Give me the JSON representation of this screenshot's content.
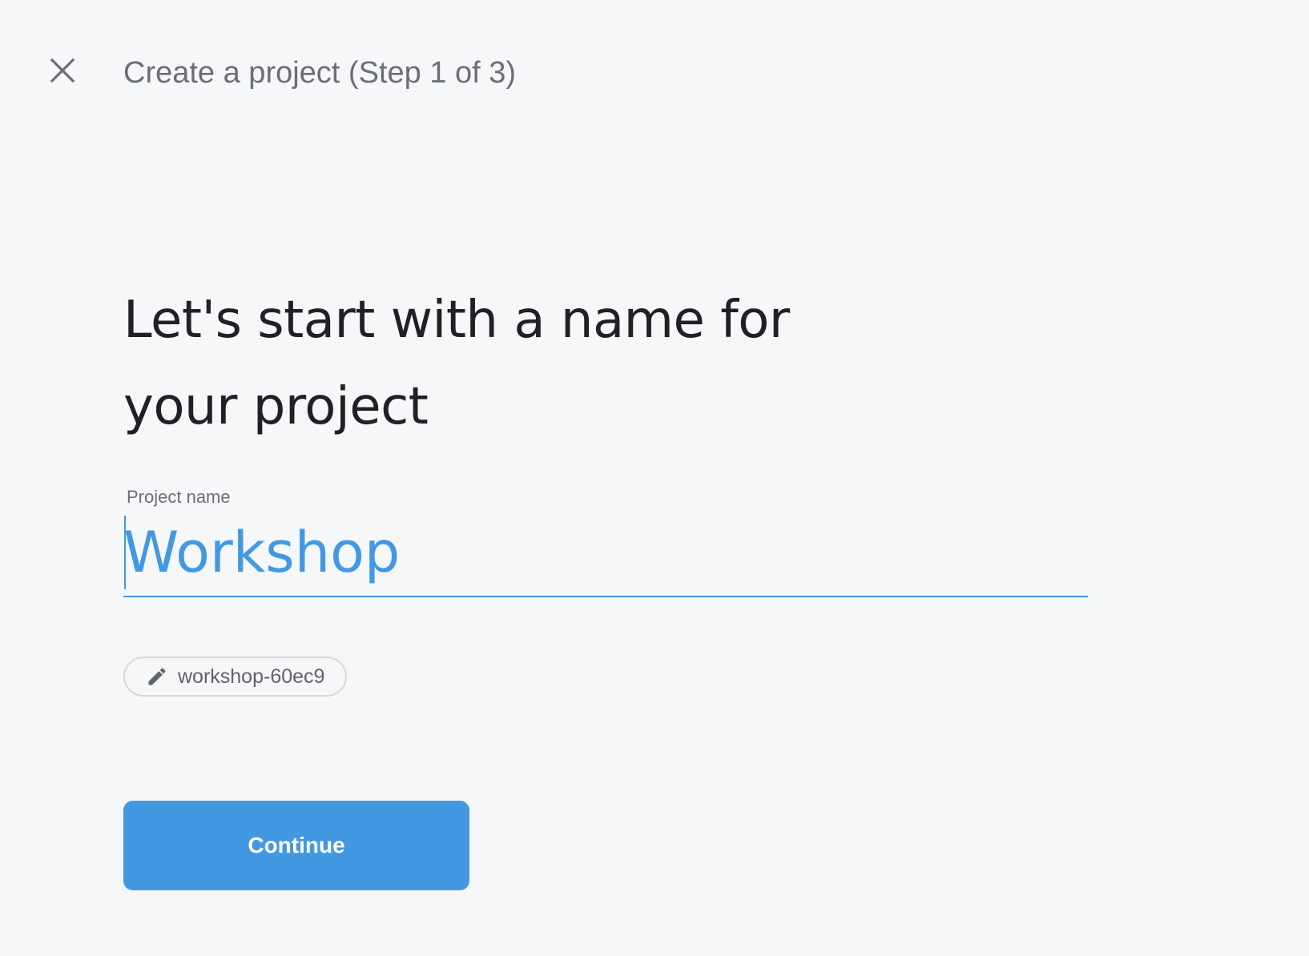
{
  "header": {
    "close_icon": "close-icon",
    "title": "Create a project (Step 1 of 3)"
  },
  "main": {
    "heading_line1": "Let's start with a name for",
    "heading_line2": "your project",
    "project_name": {
      "label": "Project name",
      "value": "Workshop"
    },
    "project_id_chip": {
      "icon": "pencil-icon",
      "label": "workshop-60ec9"
    },
    "continue_label": "Continue"
  },
  "colors": {
    "accent": "#4299e1",
    "background": "#f6f7f9",
    "heading_text": "#202124",
    "secondary_text": "#6b6f74"
  }
}
